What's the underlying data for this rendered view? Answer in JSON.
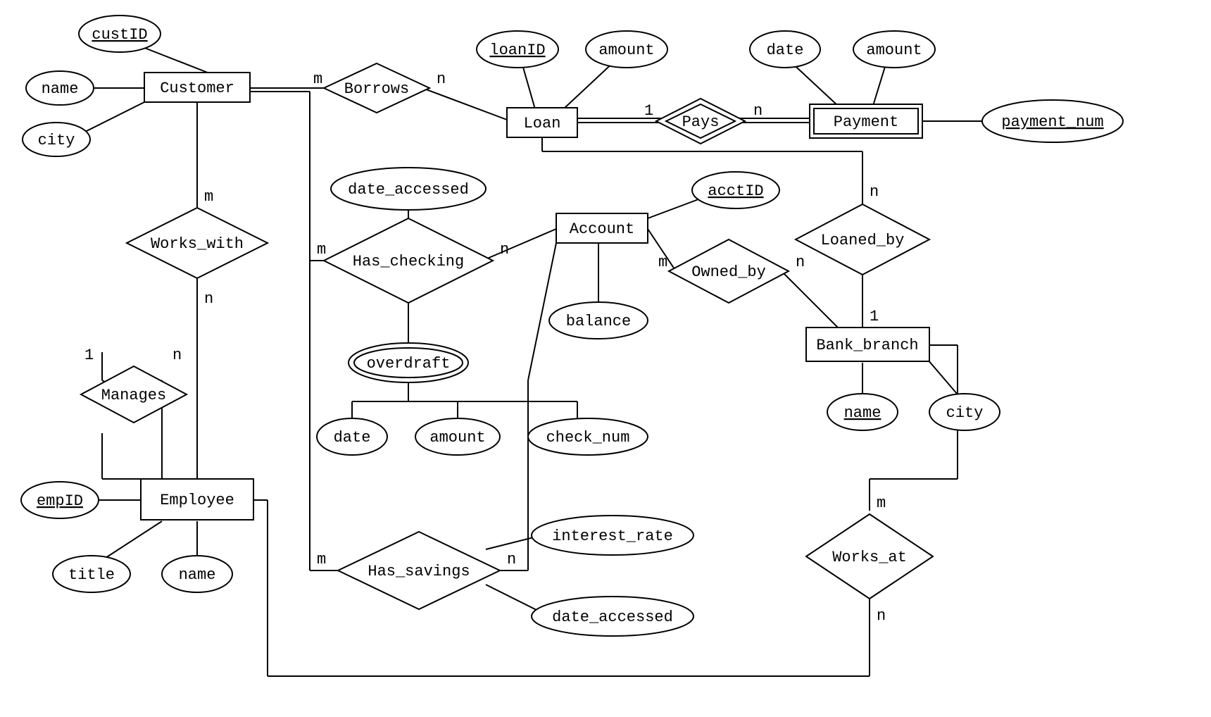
{
  "diagram": {
    "entities": {
      "customer": "Customer",
      "loan": "Loan",
      "payment": "Payment",
      "account": "Account",
      "bank_branch": "Bank_branch",
      "employee": "Employee"
    },
    "relationships": {
      "borrows": "Borrows",
      "pays": "Pays",
      "works_with": "Works_with",
      "has_checking": "Has_checking",
      "owned_by": "Owned_by",
      "loaned_by": "Loaned_by",
      "manages": "Manages",
      "has_savings": "Has_savings",
      "works_at": "Works_at"
    },
    "attributes": {
      "custID": "custID",
      "cust_name": "name",
      "cust_city": "city",
      "loanID": "loanID",
      "loan_amount": "amount",
      "pay_date": "date",
      "pay_amount": "amount",
      "payment_num": "payment_num",
      "date_accessed": "date_accessed",
      "overdraft": "overdraft",
      "od_date": "date",
      "od_amount": "amount",
      "check_num": "check_num",
      "acctID": "acctID",
      "balance": "balance",
      "bb_name": "name",
      "bb_city": "city",
      "empID": "empID",
      "emp_title": "title",
      "emp_name": "name",
      "interest_rate": "interest_rate",
      "sav_date_accessed": "date_accessed"
    },
    "cardinality": {
      "m": "m",
      "n": "n",
      "one": "1"
    }
  }
}
